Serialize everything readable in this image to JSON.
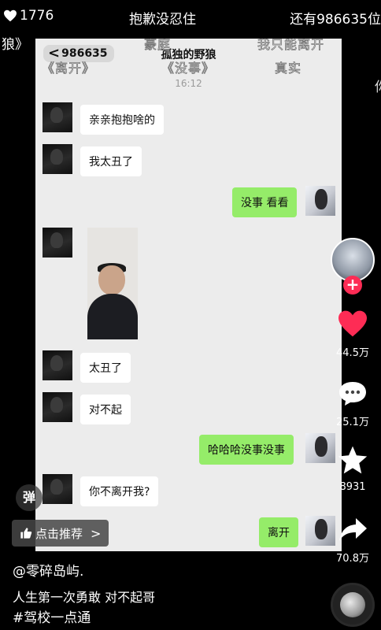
{
  "top_overlay": {
    "like_count": "1776",
    "video_title": "抱歉没忍住",
    "right_text": "还有986635位",
    "left_text": "狼》",
    "edge_text": "你"
  },
  "chat": {
    "back_count": "986635",
    "title": "孤独的野狼",
    "time": "16:12",
    "messages": [
      {
        "side": "left",
        "text": "亲亲抱抱啥的"
      },
      {
        "side": "left",
        "text": "我太丑了"
      },
      {
        "side": "right",
        "text": "没事 看看"
      },
      {
        "side": "left",
        "type": "photo"
      },
      {
        "side": "left",
        "text": "太丑了"
      },
      {
        "side": "left",
        "text": "对不起"
      },
      {
        "side": "right",
        "text": "哈哈哈没事没事"
      },
      {
        "side": "left",
        "text": "你不离开我?"
      },
      {
        "side": "right",
        "text": "离开"
      }
    ]
  },
  "lyrics": {
    "l1": "《离开》",
    "l2": "豪庭",
    "l3": "我只能离开",
    "l4": "《没事》",
    "l5": "真实"
  },
  "rail": {
    "likes": "44.5万",
    "comments": "25.1万",
    "favorites": "8931",
    "shares": "70.8万"
  },
  "controls": {
    "danmu_label": "弹",
    "recommend_label": "点击推荐"
  },
  "info": {
    "author": "@零碎岛屿.",
    "caption": "人生第一次勇敢 对不起哥",
    "hashtag": "#驾校一点通"
  },
  "colors": {
    "background": "#000000",
    "chat_bg": "#ececec",
    "bubble_right": "#95ec69",
    "bubble_left": "#ffffff",
    "like_heart": "#fe2c55"
  },
  "icons": [
    "heart-icon",
    "comment-icon",
    "star-icon",
    "share-icon",
    "thumbs-up-icon",
    "chevron-right-icon",
    "back-chevron-icon"
  ]
}
